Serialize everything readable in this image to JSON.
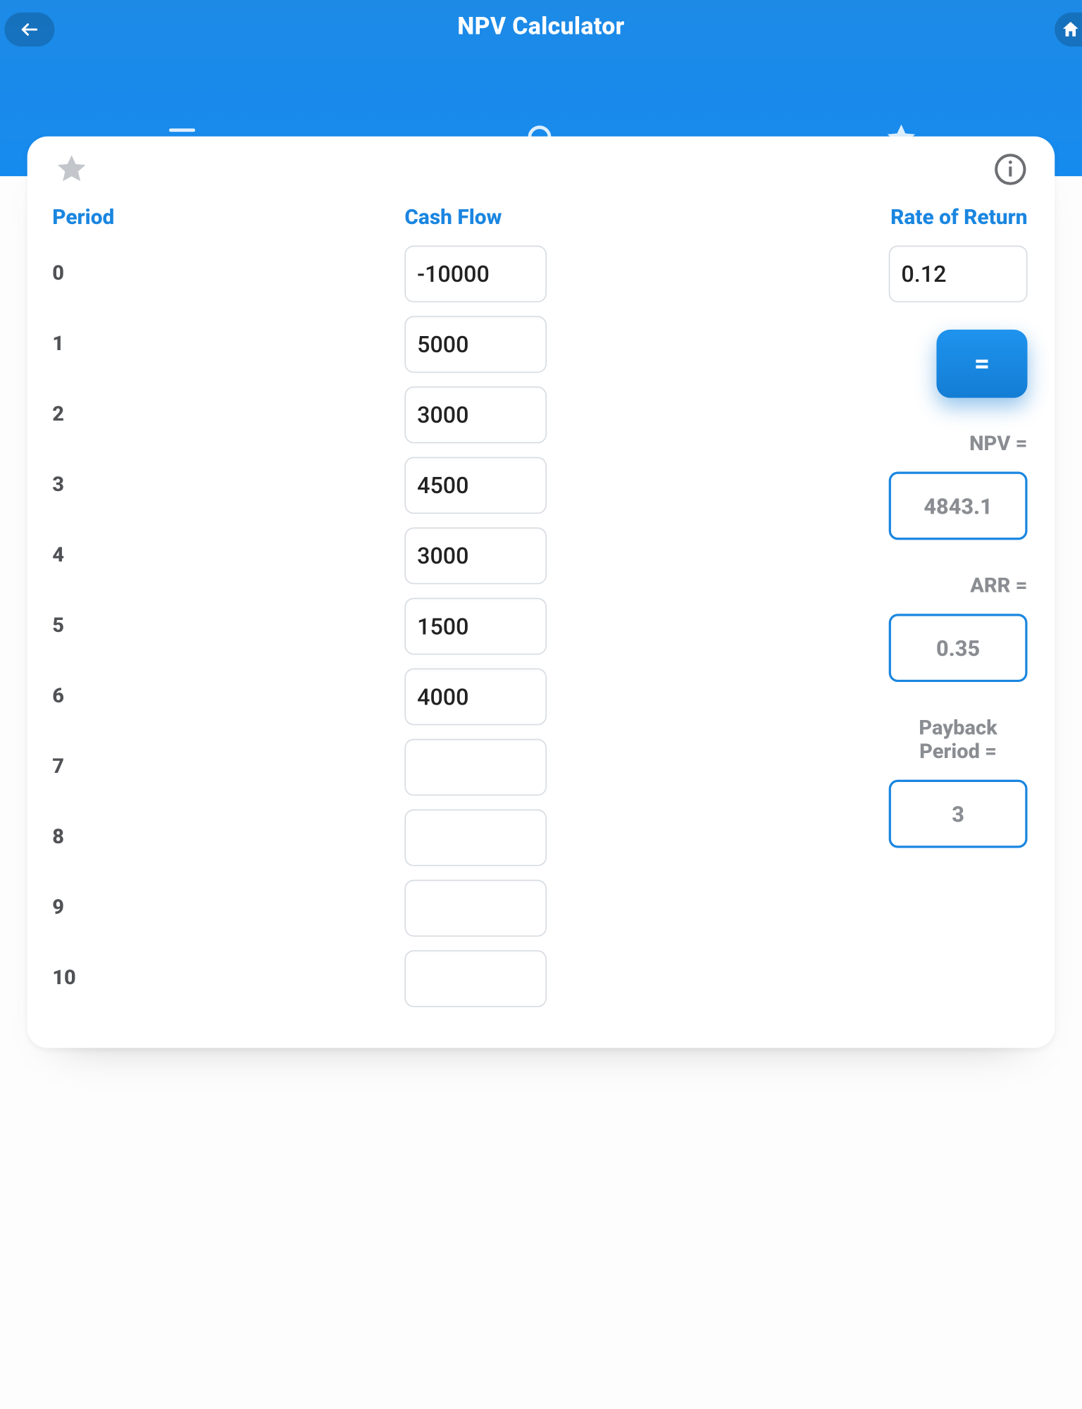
{
  "header": {
    "title": "NPV Calculator"
  },
  "columns": {
    "period_label": "Period",
    "cashflow_label": "Cash Flow",
    "rate_label": "Rate of Return"
  },
  "periods": [
    {
      "n": "0",
      "cf": "-10000"
    },
    {
      "n": "1",
      "cf": "5000"
    },
    {
      "n": "2",
      "cf": "3000"
    },
    {
      "n": "3",
      "cf": "4500"
    },
    {
      "n": "4",
      "cf": "3000"
    },
    {
      "n": "5",
      "cf": "1500"
    },
    {
      "n": "6",
      "cf": "4000"
    },
    {
      "n": "7",
      "cf": ""
    },
    {
      "n": "8",
      "cf": ""
    },
    {
      "n": "9",
      "cf": ""
    },
    {
      "n": "10",
      "cf": ""
    }
  ],
  "rate": "0.12",
  "calc_label": "=",
  "results": {
    "npv_label": "NPV =",
    "npv_value": "4843.1",
    "arr_label": "ARR =",
    "arr_value": "0.35",
    "payback_label": "Payback Period =",
    "payback_value": "3"
  }
}
